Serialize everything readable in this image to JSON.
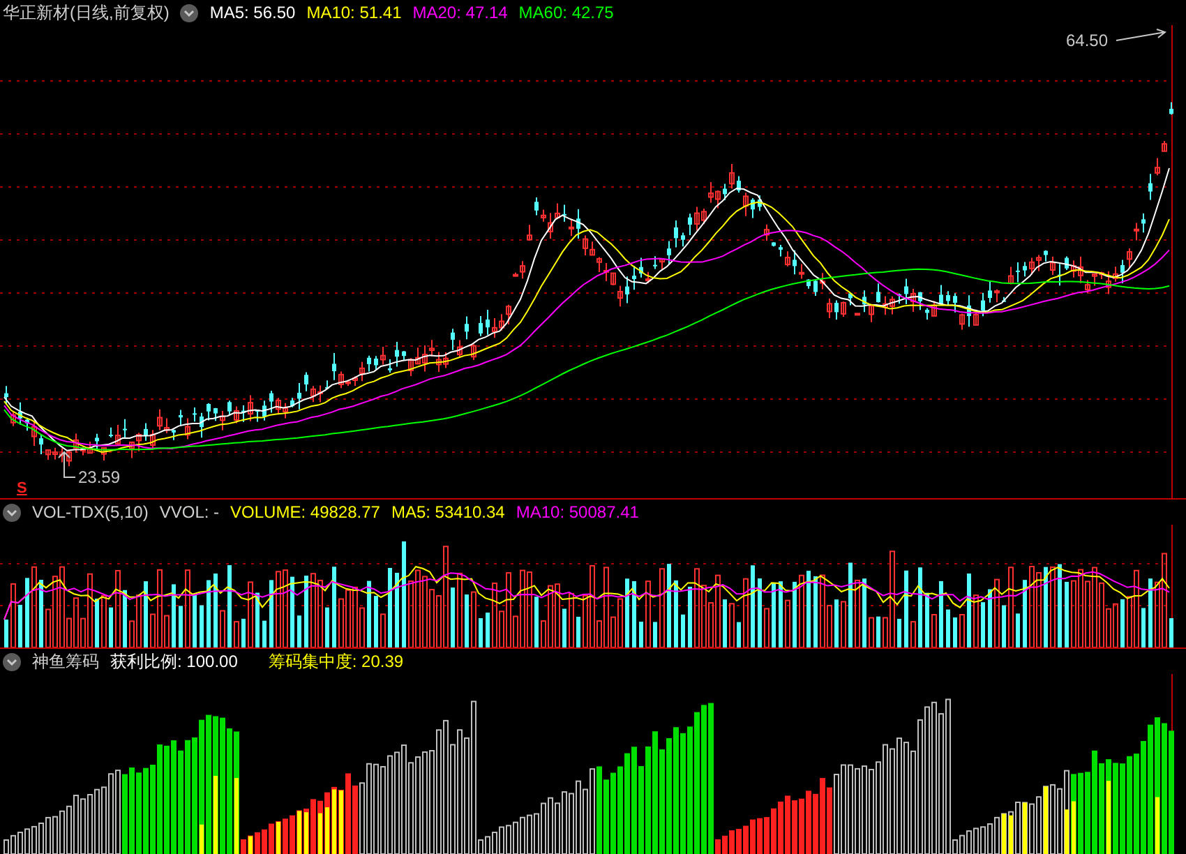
{
  "main_panel": {
    "title": "华正新材(日线,前复权)",
    "indicators": [
      {
        "label": "MA5: 56.50",
        "color": "#ffffff"
      },
      {
        "label": "MA10: 51.41",
        "color": "#ffff00"
      },
      {
        "label": "MA20: 47.14",
        "color": "#ff00ff"
      },
      {
        "label": "MA60: 42.75",
        "color": "#00ff00"
      }
    ],
    "high_label": "64.50",
    "low_label": "23.59",
    "signal_mark": "S"
  },
  "volume_panel": {
    "title": "VOL-TDX(5,10)",
    "indicators": [
      {
        "label": "VVOL: -",
        "color": "#d0d0d0"
      },
      {
        "label": "VOLUME: 49828.77",
        "color": "#ffff00"
      },
      {
        "label": "MA5: 53410.34",
        "color": "#ffff00"
      },
      {
        "label": "MA10: 50087.41",
        "color": "#ff00ff"
      }
    ]
  },
  "chip_panel": {
    "title": "神鱼筹码",
    "indicators": [
      {
        "label": "获利比例: 100.00",
        "color": "#ffffff"
      },
      {
        "label": "筹码集中度: 20.39",
        "color": "#ffff00"
      }
    ]
  }
}
